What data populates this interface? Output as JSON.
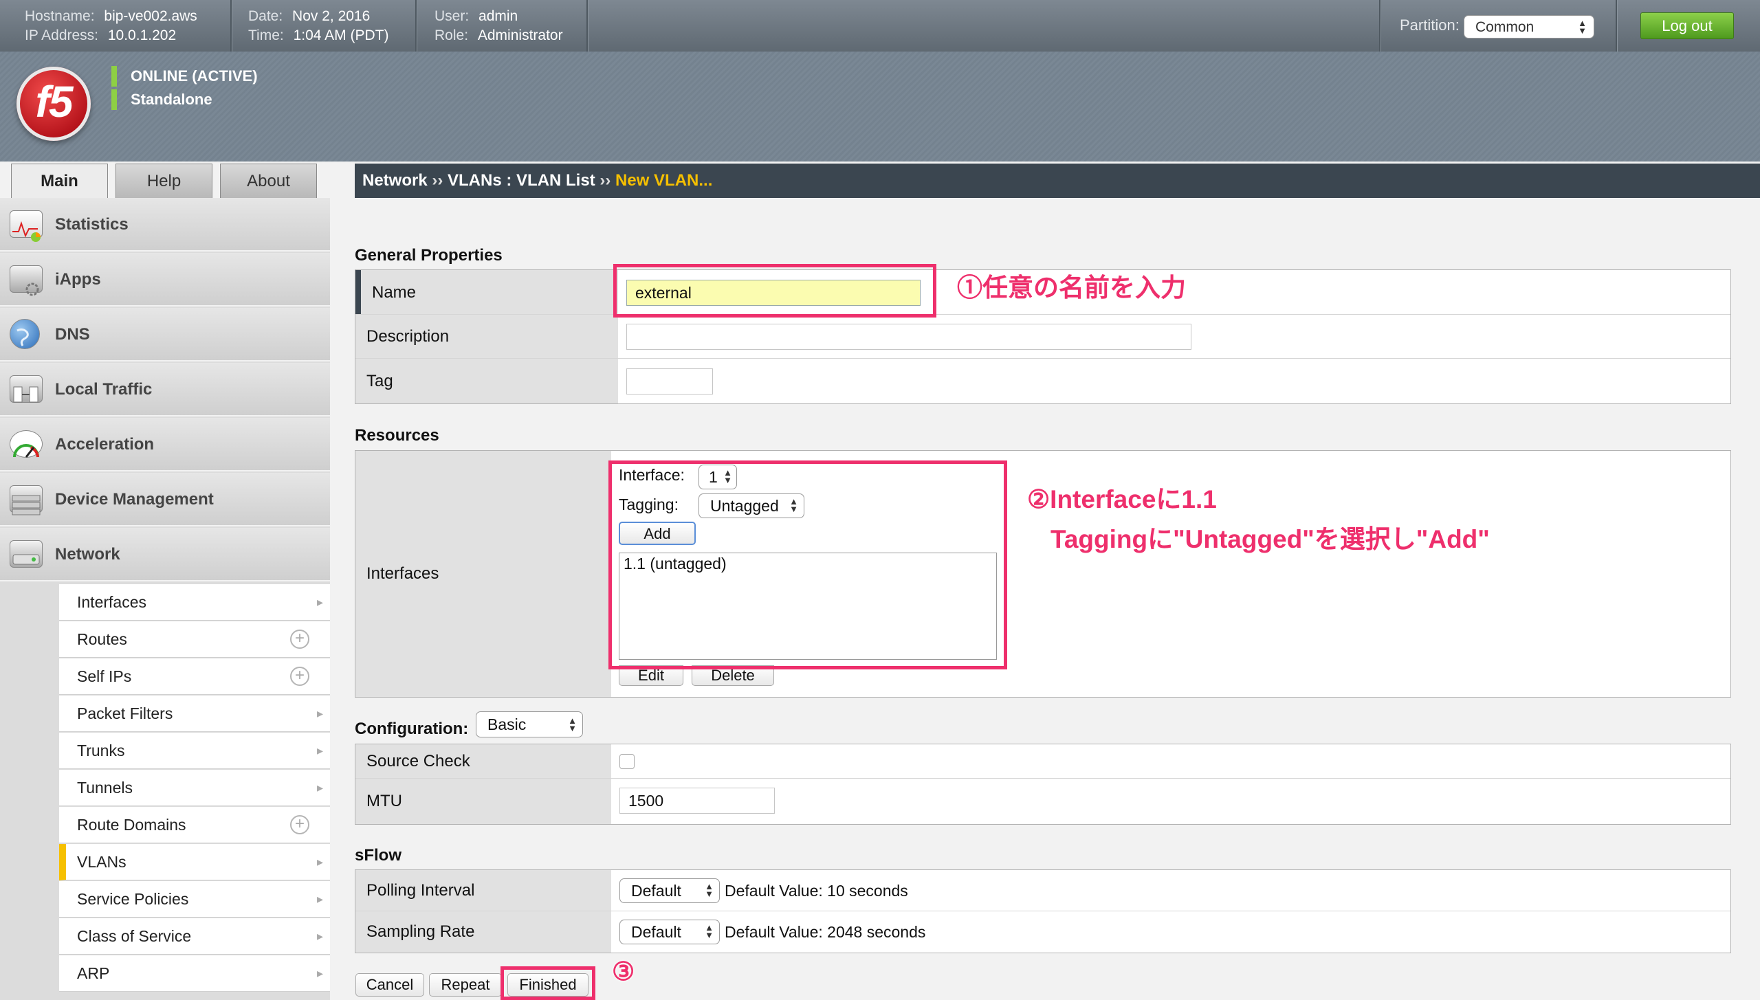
{
  "topbar": {
    "hostname_label": "Hostname:",
    "hostname": "bip-ve002.aws",
    "ip_label": "IP Address:",
    "ip": "10.0.1.202",
    "date_label": "Date:",
    "date": "Nov 2, 2016",
    "time_label": "Time:",
    "time": "1:04 AM (PDT)",
    "user_label": "User:",
    "user": "admin",
    "role_label": "Role:",
    "role": "Administrator",
    "partition_label": "Partition:",
    "partition_value": "Common",
    "logout_label": "Log out"
  },
  "header": {
    "logo_text": "f5",
    "status_1": "ONLINE (ACTIVE)",
    "status_2": "Standalone",
    "status_color": "#8ed044"
  },
  "tabs": [
    {
      "label": "Main"
    },
    {
      "label": "Help"
    },
    {
      "label": "About"
    }
  ],
  "breadcrumb": {
    "part1": "Network",
    "sep1": "››",
    "part2": "VLANs : VLAN List",
    "sep2": "››",
    "current": "New VLAN..."
  },
  "sidebar": {
    "items": [
      {
        "label": "Statistics",
        "icon": "statistics-icon"
      },
      {
        "label": "iApps",
        "icon": "iapps-icon"
      },
      {
        "label": "DNS",
        "icon": "globe-icon"
      },
      {
        "label": "Local Traffic",
        "icon": "local-traffic-icon"
      },
      {
        "label": "Acceleration",
        "icon": "gauge-icon"
      },
      {
        "label": "Device Management",
        "icon": "device-icon"
      },
      {
        "label": "Network",
        "icon": "network-icon"
      }
    ],
    "network_sub": [
      {
        "label": "Interfaces"
      },
      {
        "label": "Routes"
      },
      {
        "label": "Self IPs"
      },
      {
        "label": "Packet Filters"
      },
      {
        "label": "Trunks"
      },
      {
        "label": "Tunnels"
      },
      {
        "label": "Route Domains"
      },
      {
        "label": "VLANs"
      },
      {
        "label": "Service Policies"
      },
      {
        "label": "Class of Service"
      },
      {
        "label": "ARP"
      }
    ]
  },
  "general": {
    "title": "General Properties",
    "name_label": "Name",
    "name_value": "external",
    "description_label": "Description",
    "description_value": "",
    "tag_label": "Tag",
    "tag_value": ""
  },
  "resources": {
    "title": "Resources",
    "interfaces_label": "Interfaces",
    "interface_field_label": "Interface:",
    "interface_value": "1",
    "tagging_label": "Tagging:",
    "tagging_value": "Untagged",
    "add_label": "Add",
    "list_items": [
      "1.1 (untagged)"
    ],
    "edit_label": "Edit",
    "delete_label": "Delete"
  },
  "configuration": {
    "title": "Configuration:",
    "mode_value": "Basic",
    "source_check_label": "Source Check",
    "mtu_label": "MTU",
    "mtu_value": "1500"
  },
  "sflow": {
    "title": "sFlow",
    "polling_label": "Polling Interval",
    "polling_value": "Default",
    "polling_default": "Default Value: 10 seconds",
    "sampling_label": "Sampling Rate",
    "sampling_value": "Default",
    "sampling_default": "Default Value: 2048 seconds"
  },
  "buttons": {
    "cancel": "Cancel",
    "repeat": "Repeat",
    "finished": "Finished"
  },
  "annotations": {
    "step1": "①任意の名前を入力",
    "step2_line1": "②Interfaceに1.1",
    "step2_line2": "Taggingに\"Untagged\"を選択し\"Add\"",
    "step3": "③",
    "color": "#ee2f6c"
  }
}
